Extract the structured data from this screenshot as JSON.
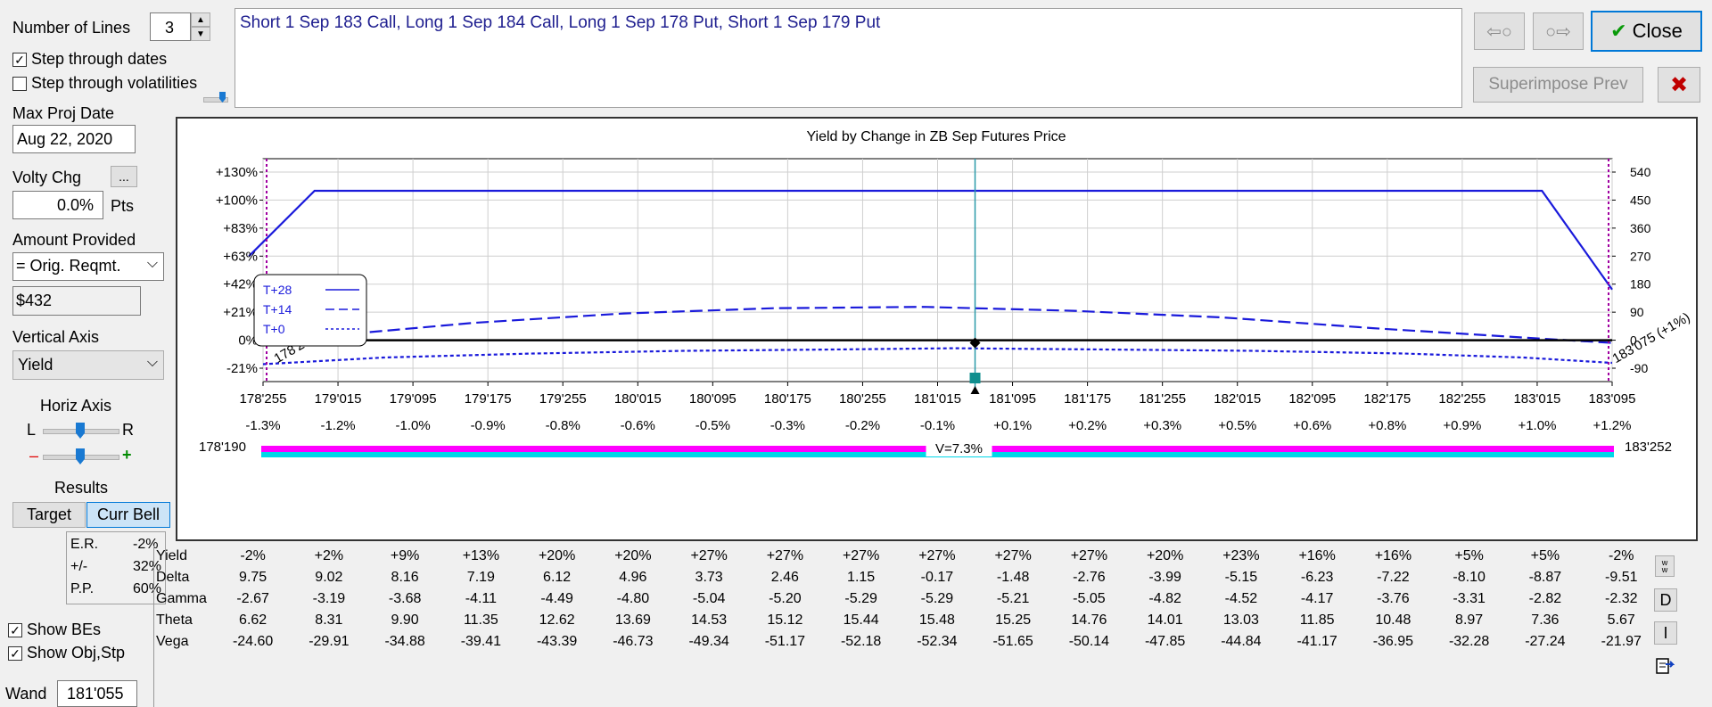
{
  "left_panel": {
    "number_of_lines_label": "Number of Lines",
    "number_of_lines_value": "3",
    "step_dates_label": "Step through dates",
    "step_dates_checked": true,
    "step_vols_label": "Step through volatilities",
    "step_vols_checked": false,
    "max_proj_date_label": "Max Proj Date",
    "max_proj_date_value": "Aug 22, 2020",
    "volty_chg_label": "Volty Chg",
    "volty_chg_button": "...",
    "volty_chg_value": "0.0%",
    "volty_chg_unit": "Pts",
    "amount_provided_label": "Amount Provided",
    "amount_provided_value": "= Orig. Reqmt.",
    "amount_value": "$432",
    "vertical_axis_label": "Vertical Axis",
    "vertical_axis_value": "Yield",
    "horiz_axis_label": "Horiz Axis",
    "horiz_left": "L",
    "horiz_right": "R",
    "zoom_minus": "–",
    "zoom_plus": "+",
    "results_label": "Results",
    "target_tab": "Target",
    "curr_bell_tab": "Curr Bell",
    "stats": [
      {
        "label": "E.R.",
        "value": "-2%"
      },
      {
        "label": "+/-",
        "value": "32%"
      },
      {
        "label": "P.P.",
        "value": "60%"
      }
    ],
    "show_bes_label": "Show BEs",
    "show_bes_checked": true,
    "show_obj_label": "Show Obj,Stp",
    "show_obj_checked": true,
    "wand_label": "Wand",
    "wand_value": "181'055"
  },
  "description": "Short 1 Sep 183 Call, Long 1 Sep 184 Call, Long 1 Sep 178 Put, Short 1 Sep 179 Put",
  "top_buttons": {
    "back_arrow": "⇦○",
    "forward_arrow": "○⇨",
    "close_label": "Close",
    "close_check": "✔",
    "superimpose_label": "Superimpose Prev",
    "cancel_x": "✖"
  },
  "chart_data": {
    "type": "line",
    "title": "Yield by Change in ZB Sep Futures Price",
    "xlim": [
      178.797,
      183.297
    ],
    "x_ticks": [
      "178'255",
      "179'015",
      "179'095",
      "179'175",
      "179'255",
      "180'015",
      "180'095",
      "180'175",
      "180'255",
      "181'015",
      "181'095",
      "181'175",
      "181'255",
      "182'015",
      "182'095",
      "182'175",
      "182'255",
      "183'015",
      "183'095"
    ],
    "x_pct_ticks": [
      "-1.3%",
      "-1.2%",
      "-1.0%",
      "-0.9%",
      "-0.8%",
      "-0.6%",
      "-0.5%",
      "-0.3%",
      "-0.2%",
      "-0.1%",
      "+0.1%",
      "+0.2%",
      "+0.3%",
      "+0.5%",
      "+0.6%",
      "+0.8%",
      "+0.9%",
      "+1.0%",
      "+1.2%"
    ],
    "y_left_ticks": [
      "+130%",
      "+100%",
      "+83%",
      "+63%",
      "+42%",
      "+21%",
      "0%",
      "-21%"
    ],
    "y_right_ticks": [
      "540",
      "450",
      "360",
      "270",
      "180",
      "90",
      "0",
      "-90"
    ],
    "ylim": [
      -21,
      130
    ],
    "series": [
      {
        "name": "T+28",
        "style": "solid",
        "x": [
          178.75,
          178.969,
          183.063,
          183.297
        ],
        "y": [
          63,
          110,
          110,
          38
        ]
      },
      {
        "name": "T+14",
        "style": "dashed",
        "x": [
          178.797,
          179.1,
          179.5,
          180.0,
          180.5,
          181.0,
          181.5,
          182.0,
          182.5,
          183.0,
          183.297
        ],
        "y": [
          0,
          5,
          13,
          20,
          24,
          25,
          22,
          17,
          9,
          2,
          -2
        ]
      },
      {
        "name": "T+0",
        "style": "dotted",
        "x": [
          178.797,
          179.2,
          179.7,
          180.2,
          180.7,
          181.1,
          181.6,
          182.1,
          182.6,
          183.0,
          183.297
        ],
        "y": [
          -18,
          -13,
          -10,
          -8,
          -7,
          -6,
          -7,
          -8,
          -10,
          -13,
          -17
        ]
      }
    ],
    "break_evens": [
      {
        "x": 178.797,
        "label": "178'255 (-1%)"
      },
      {
        "x": 183.297,
        "label": "183'075 (+1%)"
      }
    ],
    "wand_x": 181.172,
    "current_y": -2,
    "range_left_label": "178'190",
    "range_right_label": "183'252",
    "vol_label": "V=7.3%",
    "legend_placement": "left",
    "colors": {
      "line": "#1a1adb",
      "breakeven": "#a000a0",
      "wand": "#2a9aa8",
      "bell_magenta": "#ff00ff",
      "bell_cyan": "#00d8e8"
    }
  },
  "greeks_table": {
    "rows": [
      {
        "name": "Yield",
        "values": [
          "-2%",
          "+2%",
          "+9%",
          "+13%",
          "+20%",
          "+20%",
          "+27%",
          "+27%",
          "+27%",
          "+27%",
          "+27%",
          "+27%",
          "+20%",
          "+23%",
          "+16%",
          "+16%",
          "+5%",
          "+5%",
          "-2%"
        ]
      },
      {
        "name": "Delta",
        "values": [
          "9.75",
          "9.02",
          "8.16",
          "7.19",
          "6.12",
          "4.96",
          "3.73",
          "2.46",
          "1.15",
          "-0.17",
          "-1.48",
          "-2.76",
          "-3.99",
          "-5.15",
          "-6.23",
          "-7.22",
          "-8.10",
          "-8.87",
          "-9.51"
        ]
      },
      {
        "name": "Gamma",
        "values": [
          "-2.67",
          "-3.19",
          "-3.68",
          "-4.11",
          "-4.49",
          "-4.80",
          "-5.04",
          "-5.20",
          "-5.29",
          "-5.29",
          "-5.21",
          "-5.05",
          "-4.82",
          "-4.52",
          "-4.17",
          "-3.76",
          "-3.31",
          "-2.82",
          "-2.32"
        ]
      },
      {
        "name": "Theta",
        "values": [
          "6.62",
          "8.31",
          "9.90",
          "11.35",
          "12.62",
          "13.69",
          "14.53",
          "15.12",
          "15.44",
          "15.48",
          "15.25",
          "14.76",
          "14.01",
          "13.03",
          "11.85",
          "10.48",
          "8.97",
          "7.36",
          "5.67"
        ]
      },
      {
        "name": "Vega",
        "values": [
          "-24.60",
          "-29.91",
          "-34.88",
          "-39.41",
          "-43.39",
          "-46.73",
          "-49.34",
          "-51.17",
          "-52.18",
          "-52.34",
          "-51.65",
          "-50.14",
          "-47.85",
          "-44.84",
          "-41.17",
          "-36.95",
          "-32.28",
          "-27.24",
          "-21.97"
        ]
      }
    ]
  },
  "side_icons": {
    "ww": "w\nw",
    "d": "D",
    "i": "I"
  }
}
